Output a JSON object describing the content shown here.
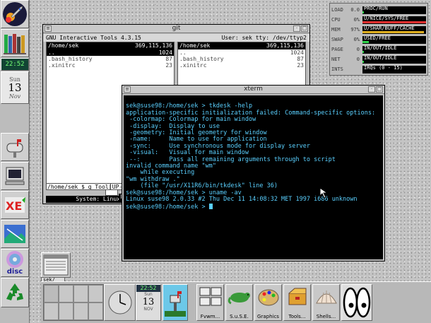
{
  "left_dock": {
    "clock_time": "22:52",
    "day": "Sun",
    "date": "13",
    "month": "Nov",
    "disc_label": "disc"
  },
  "git_window": {
    "title": "git",
    "header_left": "GNU Interactive Tools 4.3.15",
    "header_right": "User: sek  tty: /dev/ttyp2",
    "left_panel": {
      "path": "/home/sek",
      "size": "369,115,136",
      "files": [
        {
          "name": "..",
          "size": "1024"
        },
        {
          "name": ".bash_history",
          "size": "87"
        },
        {
          "name": ".xinitrc",
          "size": "23"
        }
      ]
    },
    "right_panel": {
      "path": "/home/sek",
      "size": "369,115,136",
      "files": [
        {
          "name": "..",
          "size": "1024"
        },
        {
          "name": ".bash_history",
          "size": "87"
        },
        {
          "name": ".xinitrc",
          "size": "23"
        }
      ]
    },
    "prompt": "/home/sek $ g Tool[",
    "status_left": "UP--",
    "status_bar": "System: Linux",
    "status_tail": "H"
  },
  "xterm": {
    "title": "xterm",
    "lines": [
      "sek@suse98:/home/sek > tkdesk -help",
      "application-specific initialization failed: Command-specific options:",
      " -colormap: Colormap for main window",
      " -display:  Display to use",
      " -geometry: Initial geometry for window",
      " -name:     Name to use for application",
      " -sync:     Use synchronous mode for display server",
      " -visual:   Visual for main window",
      " --:        Pass all remaining arguments through to script",
      "invalid command name \"wm\"",
      "    while executing",
      "\"wm withdraw .\"",
      "    (file \"/usr/X11R6/bin/tkdesk\" line 36)",
      "sek@suse98:/home/sek > uname -av",
      "Linux suse98 2.0.33 #2 Thu Dec 11 14:08:32 MET 1997 i686 unknown"
    ],
    "last_prompt": "sek@suse98:/home/sek > "
  },
  "monitor": {
    "rows": [
      {
        "label": "LOAD",
        "value": "0.0",
        "bar_text": "PROC/RUN",
        "fill": 0.02,
        "color": "#2fd24a"
      },
      {
        "label": "CPU",
        "value": "0%",
        "bar_text": "U/NICE/SYS/FREE",
        "fill": 1.0,
        "color": "#e03030"
      },
      {
        "label": "MEM",
        "value": "97%",
        "bar_text": "U/SHAR/BUFF/CACHE",
        "fill": 0.97,
        "color": "#e0b020"
      },
      {
        "label": "SWAP",
        "value": "0%",
        "bar_text": "USED/FREE",
        "fill": 0.1,
        "color": "#2fd24a"
      },
      {
        "label": "PAGE",
        "value": "0",
        "bar_text": "IN/OUT/IDLE",
        "fill": 0.02,
        "color": "#2fd24a"
      },
      {
        "label": "NET",
        "value": "0",
        "bar_text": "IN/OUT/IDLE",
        "fill": 0.02,
        "color": "#2fd24a"
      },
      {
        "label": "INTS",
        "value": "",
        "bar_text": "IRQs (0 - 15)",
        "fill": 0.0,
        "color": "#2fd24a"
      }
    ]
  },
  "pager": {
    "icon_label": "sek/"
  },
  "bottom_dock": {
    "date_time": "22:52",
    "date_day": "Sun",
    "date_num": "13",
    "date_month": "NOV",
    "items": [
      "Fvwm...",
      "S.u.S.E.",
      "Graphics",
      "Tools...",
      "Shells..."
    ]
  }
}
